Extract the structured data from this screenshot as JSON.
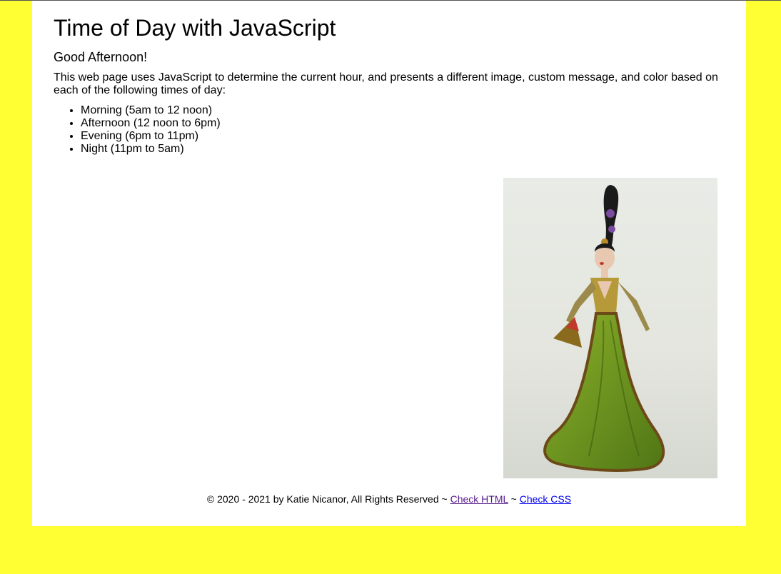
{
  "page": {
    "title": "Time of Day with JavaScript",
    "greeting": "Good Afternoon!",
    "intro": "This web page uses JavaScript to determine the current hour, and presents a different image, custom message, and color based on each of the following times of day:",
    "times": [
      "Morning (5am to 12 noon)",
      "Afternoon (12 noon to 6pm)",
      "Evening (6pm to 11pm)",
      "Night (11pm to 5am)"
    ],
    "image_subject": "doll-in-green-gown-with-fan"
  },
  "footer": {
    "copyright": "© 2020 - 2021 by Katie Nicanor, All Rights Reserved ~",
    "separator": "~",
    "check_html": "Check HTML",
    "check_css": "Check CSS"
  },
  "colors": {
    "background": "#ffff33",
    "content": "#ffffff",
    "visited_link": "#551a8b",
    "link": "#0000ee"
  }
}
